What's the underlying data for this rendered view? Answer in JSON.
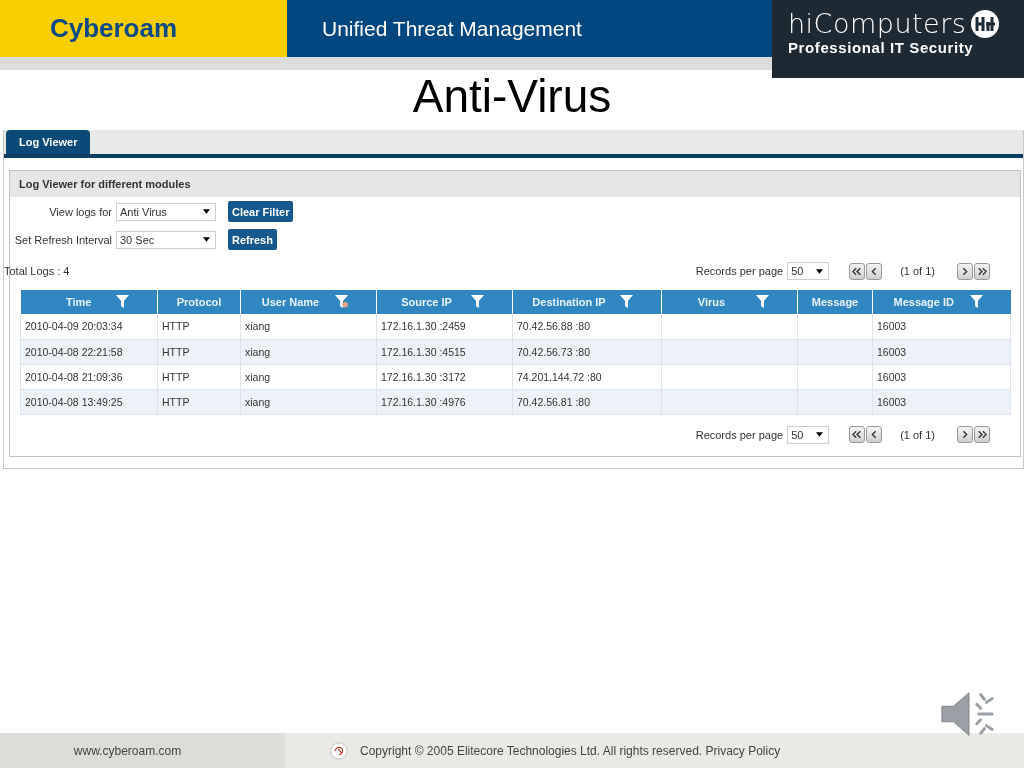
{
  "header": {
    "brand": "Cyberoam",
    "product": "Unified Threat Management",
    "partner_logo": {
      "name": "hiComputers",
      "tagline": "Professional IT Security"
    }
  },
  "slide_title": "Anti-Virus",
  "tabs": [
    {
      "label": "Log Viewer",
      "selected": true
    }
  ],
  "panel": {
    "title": "Log Viewer for different modules",
    "filters": [
      {
        "label": "View logs for",
        "value": "Anti Virus",
        "button": "Clear Filter"
      },
      {
        "label": "Set Refresh Interval",
        "value": "30 Sec",
        "button": "Refresh"
      }
    ],
    "total": "Total Logs : 4",
    "pagers": [
      {
        "label": "Records per page",
        "value": "50",
        "page": "(1 of 1)"
      },
      {
        "label": "Records per page",
        "value": "50",
        "page": "(1 of 1)"
      }
    ],
    "table": {
      "columns": [
        {
          "label": "Time",
          "filterable": true,
          "filter_applied": false
        },
        {
          "label": "Protocol",
          "filterable": false
        },
        {
          "label": "User Name",
          "filterable": true,
          "filter_applied": true
        },
        {
          "label": "Source IP",
          "filterable": true,
          "filter_applied": false
        },
        {
          "label": "Destination IP",
          "filterable": true,
          "filter_applied": false
        },
        {
          "label": "Virus",
          "filterable": true,
          "filter_applied": false
        },
        {
          "label": "Message",
          "filterable": false
        },
        {
          "label": "Message ID",
          "filterable": true,
          "filter_applied": false
        }
      ],
      "rows": [
        [
          "2010-04-09 20:03:34",
          "HTTP",
          "xiang",
          "172.16.1.30 :2459",
          "70.42.56.88 :80",
          "",
          "",
          "16003"
        ],
        [
          "2010-04-08 22:21:58",
          "HTTP",
          "xiang",
          "172.16.1.30 :4515",
          "70.42.56.73 :80",
          "",
          "",
          "16003"
        ],
        [
          "2010-04-08 21:09:36",
          "HTTP",
          "xiang",
          "172.16.1.30 :3172",
          "74.201.144.72 :80",
          "",
          "",
          "16003"
        ],
        [
          "2010-04-08 13:49:25",
          "HTTP",
          "xiang",
          "172.16.1.30 :4976",
          "70.42.56.81 :80",
          "",
          "",
          "16003"
        ]
      ]
    }
  },
  "footer": {
    "site": "www.cyberoam.com",
    "copyright": "Copyright © 2005 Elitecore Technologies Ltd. All rights reserved. Privacy Policy"
  }
}
